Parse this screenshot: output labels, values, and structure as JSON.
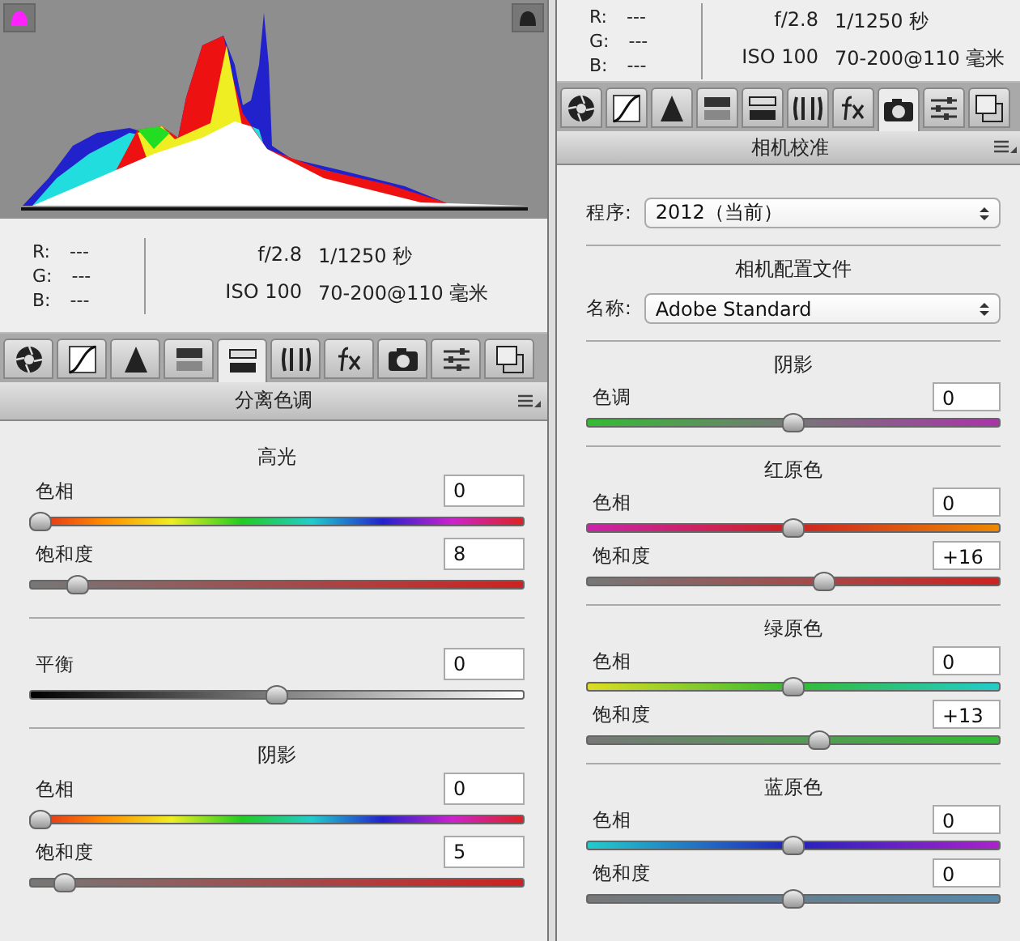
{
  "panels": [
    {
      "histogram": {
        "shadow_clipping_warning": true,
        "highlight_clipping_warning": false
      },
      "info": {
        "rgb": [
          {
            "label": "R:",
            "value": "---"
          },
          {
            "label": "G:",
            "value": "---"
          },
          {
            "label": "B:",
            "value": "---"
          }
        ],
        "lines": [
          {
            "left": "f/2.8",
            "right": "1/1250 秒"
          },
          {
            "left": "ISO 100",
            "right": "70-200@110 毫米"
          }
        ]
      },
      "tabs": [
        {
          "kind": "basic",
          "selected": false
        },
        {
          "kind": "curve",
          "selected": false
        },
        {
          "kind": "detail",
          "selected": false
        },
        {
          "kind": "hsl",
          "selected": false
        },
        {
          "kind": "split",
          "selected": true
        },
        {
          "kind": "lens",
          "selected": false
        },
        {
          "kind": "fx",
          "selected": false
        },
        {
          "kind": "camera",
          "selected": false
        },
        {
          "kind": "presets",
          "selected": false
        },
        {
          "kind": "snapshots",
          "selected": false
        }
      ],
      "header": "分离色调",
      "groups": [
        {
          "title": "高光",
          "controls": [
            {
              "kind": "hue",
              "label": "色相",
              "value": "0",
              "level": 0
            },
            {
              "kind": "redsat",
              "label": "饱和度",
              "value": "8",
              "level": 0.08
            }
          ]
        },
        {
          "controls": [
            {
              "kind": "balance",
              "label": "平衡",
              "value": "0",
              "level": 0.5
            }
          ]
        },
        {
          "title": "阴影",
          "controls": [
            {
              "kind": "hue",
              "label": "色相",
              "value": "0",
              "level": 0
            },
            {
              "kind": "redsat",
              "label": "饱和度",
              "value": "5",
              "level": 0.05
            }
          ]
        }
      ]
    },
    {
      "info": {
        "rgb": [
          {
            "label": "R:",
            "value": "---"
          },
          {
            "label": "G:",
            "value": "---"
          },
          {
            "label": "B:",
            "value": "---"
          }
        ],
        "lines": [
          {
            "left": "f/2.8",
            "right": "1/1250 秒"
          },
          {
            "left": "ISO 100",
            "right": "70-200@110 毫米"
          }
        ]
      },
      "tabs": [
        {
          "kind": "basic",
          "selected": false
        },
        {
          "kind": "curve",
          "selected": false
        },
        {
          "kind": "detail",
          "selected": false
        },
        {
          "kind": "hsl",
          "selected": false
        },
        {
          "kind": "split",
          "selected": false
        },
        {
          "kind": "lens",
          "selected": false
        },
        {
          "kind": "fx",
          "selected": false
        },
        {
          "kind": "camera",
          "selected": true
        },
        {
          "kind": "presets",
          "selected": false
        },
        {
          "kind": "snapshots",
          "selected": false
        }
      ],
      "header": "相机校准",
      "groups": [
        {
          "controls": [
            {
              "kind": "dropdown",
              "label": "程序:",
              "value": "2012（当前）"
            }
          ]
        },
        {
          "title": "相机配置文件",
          "controls": [
            {
              "kind": "dropdown",
              "label": "名称:",
              "value": "Adobe Standard"
            }
          ]
        },
        {
          "title": "阴影",
          "controls": [
            {
              "kind": "tint",
              "label": "色调",
              "value": "0",
              "level": 0.5
            }
          ]
        },
        {
          "title": "红原色",
          "controls": [
            {
              "kind": "redhue",
              "label": "色相",
              "value": "0",
              "level": 0.5
            },
            {
              "kind": "redsat",
              "label": "饱和度",
              "value": "+16",
              "level": 0.58
            }
          ]
        },
        {
          "title": "绿原色",
          "controls": [
            {
              "kind": "greenhue",
              "label": "色相",
              "value": "0",
              "level": 0.5
            },
            {
              "kind": "greensat",
              "label": "饱和度",
              "value": "+13",
              "level": 0.565
            }
          ]
        },
        {
          "title": "蓝原色",
          "controls": [
            {
              "kind": "bluehue",
              "label": "色相",
              "value": "0",
              "level": 0.5
            },
            {
              "kind": "bluesat",
              "label": "饱和度",
              "value": "0",
              "level": 0.5
            }
          ]
        }
      ]
    }
  ]
}
